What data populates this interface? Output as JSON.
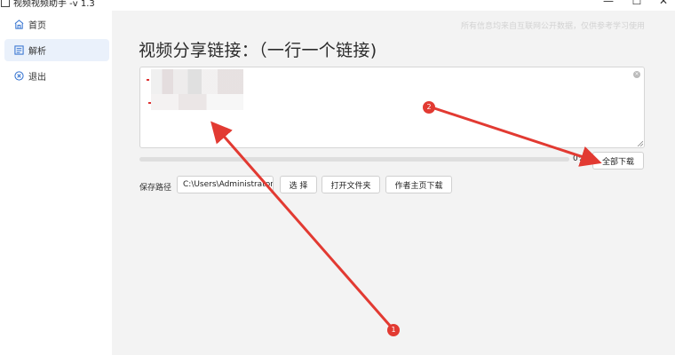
{
  "window": {
    "title": "视频视频助手 -v 1.3",
    "minimize_glyph": "—",
    "maximize_glyph": "☐",
    "close_glyph": "✕"
  },
  "sidebar": {
    "items": [
      {
        "label": "首页",
        "icon": "home-icon",
        "active": false
      },
      {
        "label": "解析",
        "icon": "parse-icon",
        "active": true
      },
      {
        "label": "退出",
        "icon": "exit-icon",
        "active": false
      }
    ]
  },
  "main": {
    "watermark": "所有信息均来自互联网公开数据，仅供参考学习使用",
    "heading": "视频分享链接：（一行一个链接)",
    "textarea": {
      "value": "",
      "clear_glyph": "×"
    },
    "progress": {
      "value": 0,
      "text": "0%"
    },
    "buttons": {
      "download_all": "全部下载",
      "choose": "选 择",
      "open_folder": "打开文件夹",
      "author_download": "作者主页下载"
    },
    "save_path": {
      "label": "保存路径",
      "value": "C:\\Users\\Administrator\\"
    }
  },
  "annotations": {
    "markers": [
      {
        "label": "1"
      },
      {
        "label": "2"
      }
    ],
    "color": "#e23a32"
  },
  "colors": {
    "sidebar_active": "#eaf1fb",
    "main_bg": "#f3f3f3",
    "accent_red": "#e23a32"
  }
}
